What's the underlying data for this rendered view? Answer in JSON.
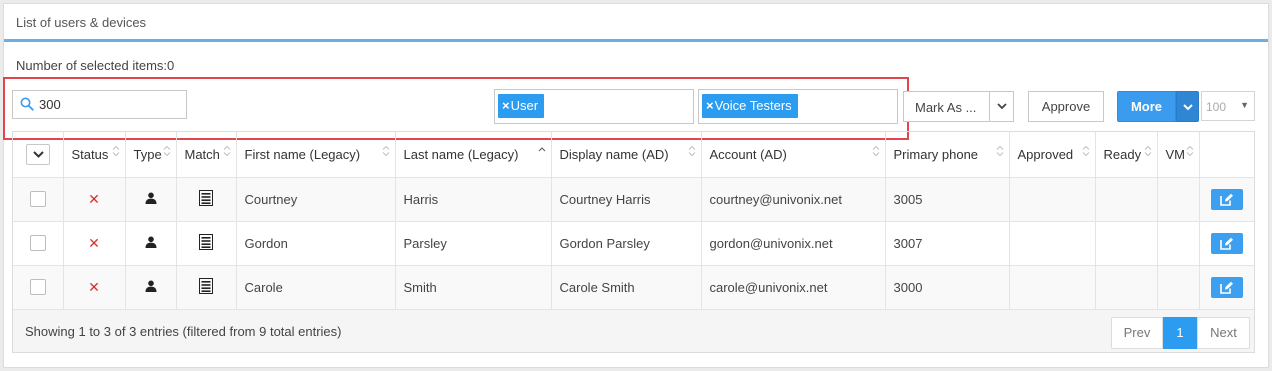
{
  "panel": {
    "title": "List of users & devices"
  },
  "selection": {
    "count_text": "Number of selected items:0"
  },
  "search": {
    "value": "300",
    "icon": "search-icon"
  },
  "filters": [
    {
      "label": "User",
      "remove": "×"
    },
    {
      "label": "Voice Testers",
      "remove": "×"
    }
  ],
  "toolbar": {
    "mark_as_label": "Mark As ...",
    "approve_label": "Approve",
    "more_label": "More",
    "page_size": "100"
  },
  "table": {
    "columns": [
      "Status",
      "Type",
      "Match",
      "First name (Legacy)",
      "Last name (Legacy)",
      "Display name (AD)",
      "Account (AD)",
      "Primary phone",
      "Approved",
      "Ready",
      "VM"
    ],
    "rows": [
      {
        "status": "✕",
        "first": "Courtney",
        "last": "Harris",
        "display": "Courtney Harris",
        "account": "courtney@univonix.net",
        "phone": "3005",
        "approved": "",
        "ready": "",
        "vm": ""
      },
      {
        "status": "✕",
        "first": "Gordon",
        "last": "Parsley",
        "display": "Gordon Parsley",
        "account": "gordon@univonix.net",
        "phone": "3007",
        "approved": "",
        "ready": "",
        "vm": ""
      },
      {
        "status": "✕",
        "first": "Carole",
        "last": "Smith",
        "display": "Carole Smith",
        "account": "carole@univonix.net",
        "phone": "3000",
        "approved": "",
        "ready": "",
        "vm": ""
      }
    ]
  },
  "footer": {
    "entries_text": "Showing 1 to 3 of 3 entries (filtered from 9 total entries)",
    "prev": "Prev",
    "current_page": "1",
    "next": "Next"
  },
  "colors": {
    "accent": "#2b9cf0",
    "highlight": "#e0474c",
    "status_error": "#d9312b"
  }
}
